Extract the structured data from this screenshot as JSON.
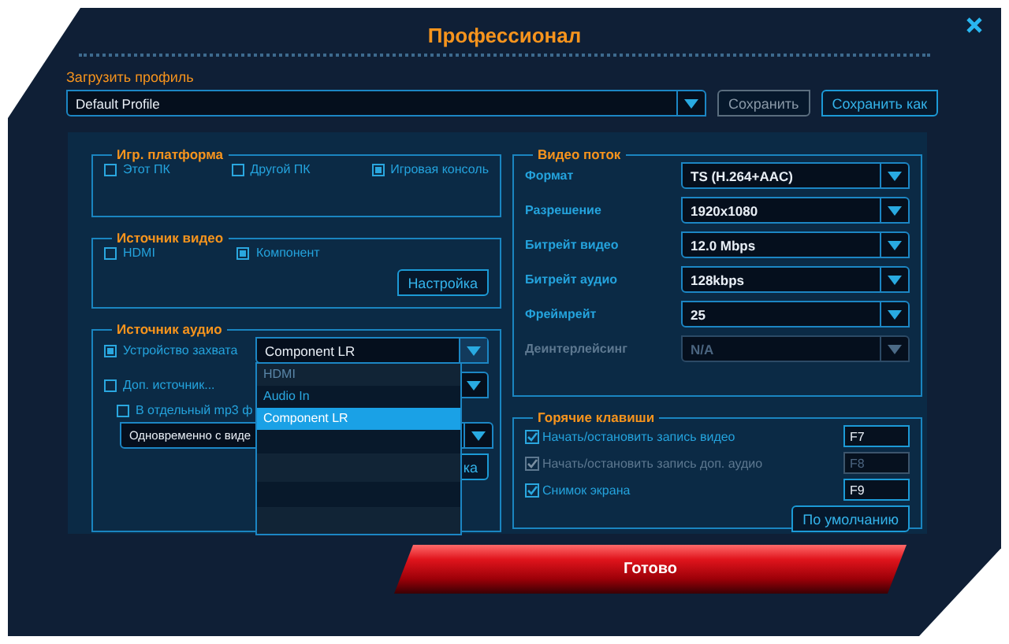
{
  "window": {
    "title": "Профессионал"
  },
  "profile": {
    "label": "Загрузить профиль",
    "value": "Default Profile",
    "buttons": [
      {
        "label": "Сохранить",
        "disabled": true
      },
      {
        "label": "Сохранить как",
        "disabled": false
      }
    ]
  },
  "platform": {
    "title": "Игр. платформа",
    "options": [
      {
        "label": "Этот ПК",
        "checked": false
      },
      {
        "label": "Другой ПК",
        "checked": false
      },
      {
        "label": "Игровая консоль",
        "checked": true
      }
    ]
  },
  "video_source": {
    "title": "Источник видео",
    "options": [
      {
        "label": "HDMI",
        "checked": false
      },
      {
        "label": "Компонент",
        "checked": true
      }
    ],
    "button": "Настройка"
  },
  "audio_source": {
    "title": "Источник аудио",
    "capture": {
      "label": "Устройство захвата",
      "checked": true,
      "value": "Component LR",
      "expanded": true,
      "options": [
        {
          "label": "HDMI",
          "selected": false,
          "disabled": true
        },
        {
          "label": "Audio In",
          "selected": false,
          "disabled": false
        },
        {
          "label": "Component LR",
          "selected": true,
          "disabled": false
        }
      ]
    },
    "extra": {
      "label": "Доп. источник...",
      "checked": false
    },
    "mp3": {
      "label": "В отдельный mp3 ф",
      "checked": false
    },
    "mode": {
      "value": "Одновременно с виде"
    },
    "button": "ка"
  },
  "video_stream": {
    "title": "Видео поток",
    "rows": [
      {
        "label": "Формат",
        "value": "TS (H.264+AAC)",
        "disabled": false
      },
      {
        "label": "Разрешение",
        "value": "1920x1080",
        "disabled": false
      },
      {
        "label": "Битрейт видео",
        "value": "12.0 Mbps",
        "disabled": false
      },
      {
        "label": "Битрейт аудио",
        "value": "128kbps",
        "disabled": false
      },
      {
        "label": "Фреймрейт",
        "value": "25",
        "disabled": false
      },
      {
        "label": "Деинтерлейсинг",
        "value": "N/A",
        "disabled": true
      }
    ]
  },
  "hotkeys": {
    "title": "Горячие клавиши",
    "rows": [
      {
        "label": "Начать/остановить запись видео",
        "checked": true,
        "disabled": false,
        "key": "F7"
      },
      {
        "label": "Начать/остановить запись доп. аудио",
        "checked": true,
        "disabled": true,
        "key": "F8"
      },
      {
        "label": "Снимок экрана",
        "checked": true,
        "disabled": false,
        "key": "F9"
      }
    ],
    "button": "По умолчанию"
  },
  "done_button": "Готово"
}
